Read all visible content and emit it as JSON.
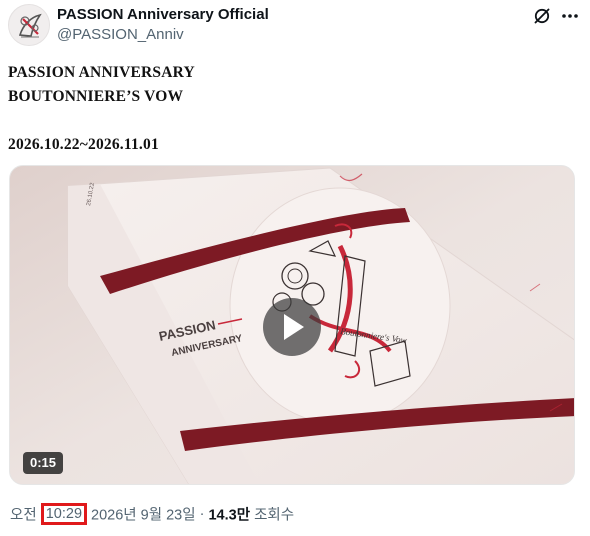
{
  "account": {
    "display_name": "PASSION Anniversary Official",
    "handle": "@PASSION_Anniv",
    "avatar_icon": "passion-logo-avatar"
  },
  "header_icons": [
    "grok-icon",
    "more-icon"
  ],
  "tweet": {
    "line1": "PASSION ANNIVERSARY",
    "line2": "BOUTONNIERE’S VOW",
    "dates": "2026.10.22~2026.11.01"
  },
  "media": {
    "type": "video",
    "duration": "0:15",
    "package_brand_line1": "PASSION",
    "package_brand_line2": "ANNIVERSARY",
    "package_script_text": "Boutonniere's Vow",
    "package_corner_text": "26.10.22",
    "colors": {
      "ribbon": "#7d1a24",
      "paper": "#f4ecea",
      "accent_red": "#c8283a"
    }
  },
  "meta": {
    "ampm": "오전",
    "time": "10:29",
    "date": "2026년 9월 23일",
    "separator": "·",
    "views_count": "14.3만",
    "views_label": "조회수"
  },
  "highlight_color": "#e0191b"
}
